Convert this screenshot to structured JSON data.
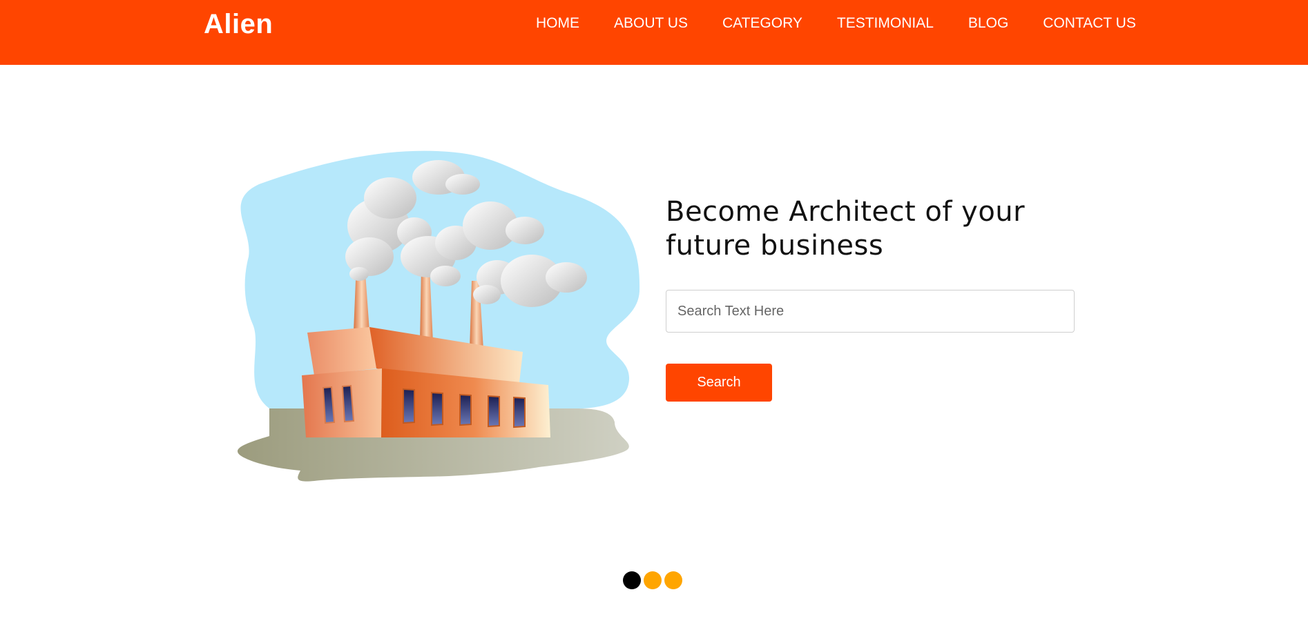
{
  "header": {
    "brand": "Alien",
    "nav": [
      {
        "label": "HOME"
      },
      {
        "label": "ABOUT US"
      },
      {
        "label": "CATEGORY"
      },
      {
        "label": "TESTIMONIAL"
      },
      {
        "label": "BLOG"
      },
      {
        "label": "CONTACT US"
      }
    ]
  },
  "hero": {
    "title": "Become Architect of your future business",
    "search": {
      "placeholder": "Search Text Here",
      "value": ""
    },
    "search_button": "Search"
  },
  "carousel": {
    "active_index": 0,
    "count": 3
  },
  "colors": {
    "accent": "#ff4500",
    "dot_active": "#000000",
    "dot_inactive": "#ffa500"
  },
  "icons": {
    "illustration": "factory-illustration"
  }
}
